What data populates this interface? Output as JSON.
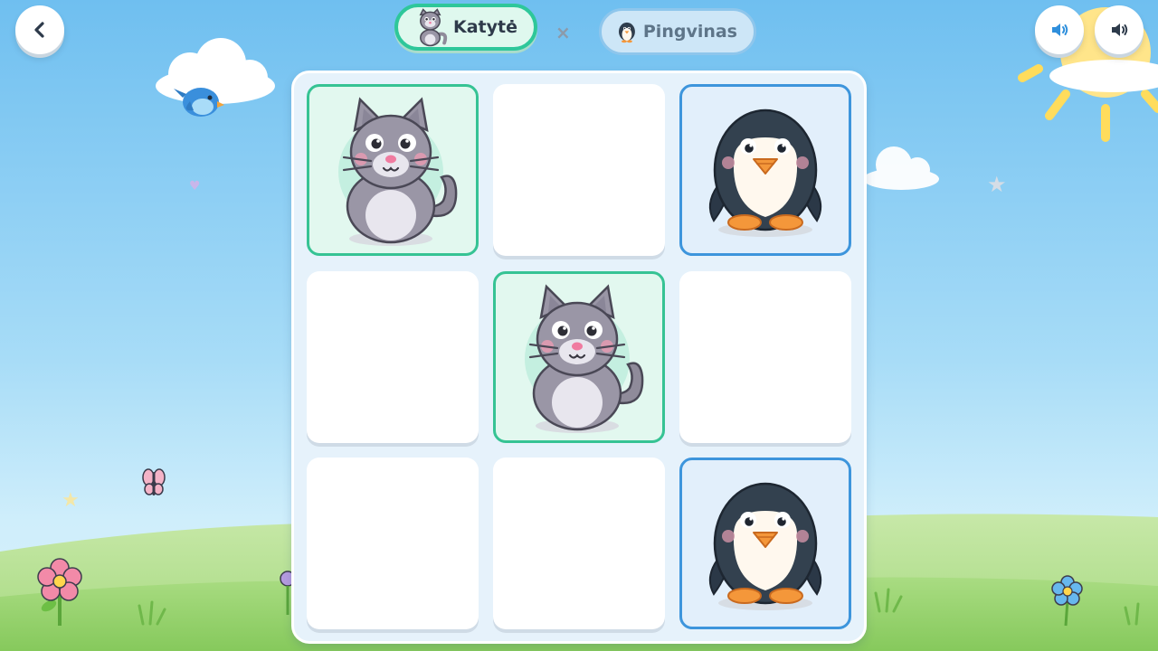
{
  "header": {
    "back_icon": "chevron-left-icon",
    "players": [
      {
        "name": "Katytė",
        "icon": "cat-icon",
        "active": true,
        "color": "#2ec79a"
      },
      {
        "name": "Pingvinas",
        "icon": "penguin-icon",
        "active": false,
        "color": "#3d95dc"
      }
    ],
    "versus": "×",
    "sound_buttons": [
      "sound-effects-icon",
      "music-volume-icon"
    ]
  },
  "board": {
    "cells": [
      "cat",
      "",
      "penguin",
      "",
      "cat",
      "",
      "",
      "",
      "penguin"
    ]
  },
  "colors": {
    "sky_top": "#6fbff0",
    "grass": "#8fd06a",
    "cat_border": "#36c394",
    "penguin_border": "#3d95dc"
  }
}
